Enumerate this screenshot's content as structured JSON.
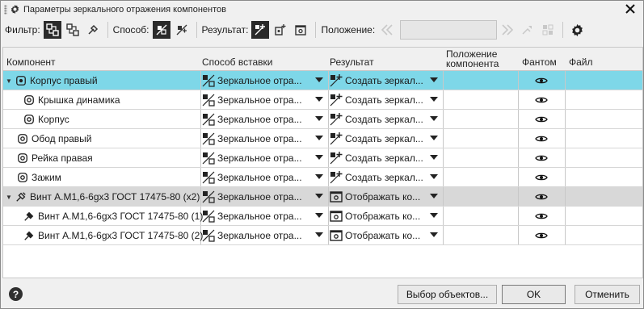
{
  "window": {
    "title": "Параметры зеркального отражения компонентов"
  },
  "toolbar": {
    "filter_label": "Фильтр:",
    "method_label": "Способ:",
    "result_label": "Результат:",
    "position_label": "Положение:",
    "position_value": "",
    "icons": [
      "filter-parts-icon",
      "filter-subassembly-icon",
      "filter-standard-icon",
      "mirror-method-icon",
      "mirror-method-alt-icon",
      "create-mirror-result-icon",
      "insert-component-icon",
      "display-component-icon",
      "prev-double-chevron-icon",
      "next-double-chevron-icon",
      "position-action-icon",
      "position-grid-icon",
      "settings-gear-icon"
    ]
  },
  "columns": {
    "component": "Компонент",
    "method": "Способ вставки",
    "result": "Результат",
    "position": "Положение компонента",
    "phantom": "Фантом",
    "file": "Файл"
  },
  "rows": [
    {
      "name": "Корпус правый",
      "method": "Зеркальное отра...",
      "result": "Создать зеркал...",
      "state": "selected",
      "level": 0,
      "expander": "▼",
      "icon": "assembly-icon",
      "result_icon": "create-mirror-icon"
    },
    {
      "name": "Крышка динамика",
      "method": "Зеркальное отра...",
      "result": "Создать зеркал...",
      "state": "normal",
      "level": 1,
      "expander": "",
      "icon": "part-icon",
      "result_icon": "create-mirror-icon"
    },
    {
      "name": "Корпус",
      "method": "Зеркальное отра...",
      "result": "Создать зеркал...",
      "state": "normal",
      "level": 1,
      "expander": "",
      "icon": "part-icon",
      "result_icon": "create-mirror-icon"
    },
    {
      "name": "Обод правый",
      "method": "Зеркальное отра...",
      "result": "Создать зеркал...",
      "state": "normal",
      "level": 0,
      "expander": "",
      "icon": "part-icon",
      "result_icon": "create-mirror-icon"
    },
    {
      "name": "Рейка правая",
      "method": "Зеркальное отра...",
      "result": "Создать зеркал...",
      "state": "normal",
      "level": 0,
      "expander": "",
      "icon": "part-icon",
      "result_icon": "create-mirror-icon"
    },
    {
      "name": "Зажим",
      "method": "Зеркальное отра...",
      "result": "Создать зеркал...",
      "state": "normal",
      "level": 0,
      "expander": "",
      "icon": "part-icon",
      "result_icon": "create-mirror-icon"
    },
    {
      "name": "Винт А.М1,6-6gx3 ГОСТ 17475-80 (x2)",
      "method": "Зеркальное отра...",
      "result": "Отображать ко...",
      "state": "group",
      "level": 0,
      "expander": "▼",
      "icon": "standard-group-icon",
      "result_icon": "display-component-icon"
    },
    {
      "name": "Винт А.М1,6-6gx3 ГОСТ 17475-80 (1)",
      "method": "Зеркальное отра...",
      "result": "Отображать ко...",
      "state": "normal",
      "level": 1,
      "expander": "",
      "icon": "standard-part-icon",
      "result_icon": "display-component-icon"
    },
    {
      "name": "Винт А.М1,6-6gx3 ГОСТ 17475-80 (2)",
      "method": "Зеркальное отра...",
      "result": "Отображать ко...",
      "state": "normal",
      "level": 1,
      "expander": "",
      "icon": "standard-part-icon",
      "result_icon": "display-component-icon"
    }
  ],
  "buttons": {
    "select_objects": "Выбор объектов...",
    "ok": "OK",
    "cancel": "Отменить",
    "help": "?"
  },
  "colors": {
    "selected_row": "#7ed7e8",
    "group_row": "#d8d8d8",
    "active_toggle": "#2b2b2b"
  }
}
